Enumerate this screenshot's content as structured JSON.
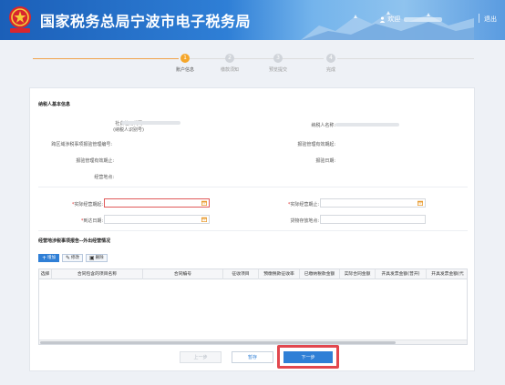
{
  "header": {
    "title": "国家税务总局宁波市电子税务局",
    "welcome": "欢迎",
    "logout": "退出",
    "emblem_text": "中国税务"
  },
  "steps": [
    {
      "num": "1",
      "label": "账户信息",
      "active": true
    },
    {
      "num": "2",
      "label": "缴款须知",
      "active": false
    },
    {
      "num": "3",
      "label": "预览提交",
      "active": false
    },
    {
      "num": "4",
      "label": "完成",
      "active": false
    }
  ],
  "basic_info": {
    "section_title": "纳税人基本信息",
    "credit_code_label_1": "社会信用代码:",
    "credit_code_label_2": "(纳税人识别号)",
    "taxpayer_name_label": "纳税人名称:",
    "cross_region_no_label": "跨区域涉税事项报验管理编号:",
    "verify_start_label": "报验管理有效期起:",
    "verify_end_label": "报验管理有效期止:",
    "verify_date_label": "报验日期:",
    "business_address_label": "经营地点:"
  },
  "form": {
    "actual_start_label": "实际经营期起:",
    "actual_end_label": "实际经营期止:",
    "arrival_date_label": "到达日期:",
    "goods_location_label": "货物存放地点:",
    "actual_start_value": "",
    "actual_end_value": "",
    "arrival_date_value": "",
    "goods_location_value": ""
  },
  "activity": {
    "section_title": "经营地涉税事项报告--外出经营情况",
    "add_label": "增加",
    "edit_label": "修改",
    "delete_label": "删除"
  },
  "grid": {
    "columns": [
      "选择",
      "合同包含的项目名称",
      "合同编号",
      "征收项目",
      "预缴税款征收率",
      "已缴纳税款金额",
      "实际合同金额",
      "开具发票金额(普开)",
      "开具发票金额(代"
    ],
    "rows": []
  },
  "buttons": {
    "prev": "上一步",
    "save": "暂存",
    "next": "下一步"
  },
  "colors": {
    "accent": "#2f7fd6",
    "step_active": "#f5a62a",
    "highlight": "#e2474e",
    "required": "#e03b3b"
  }
}
